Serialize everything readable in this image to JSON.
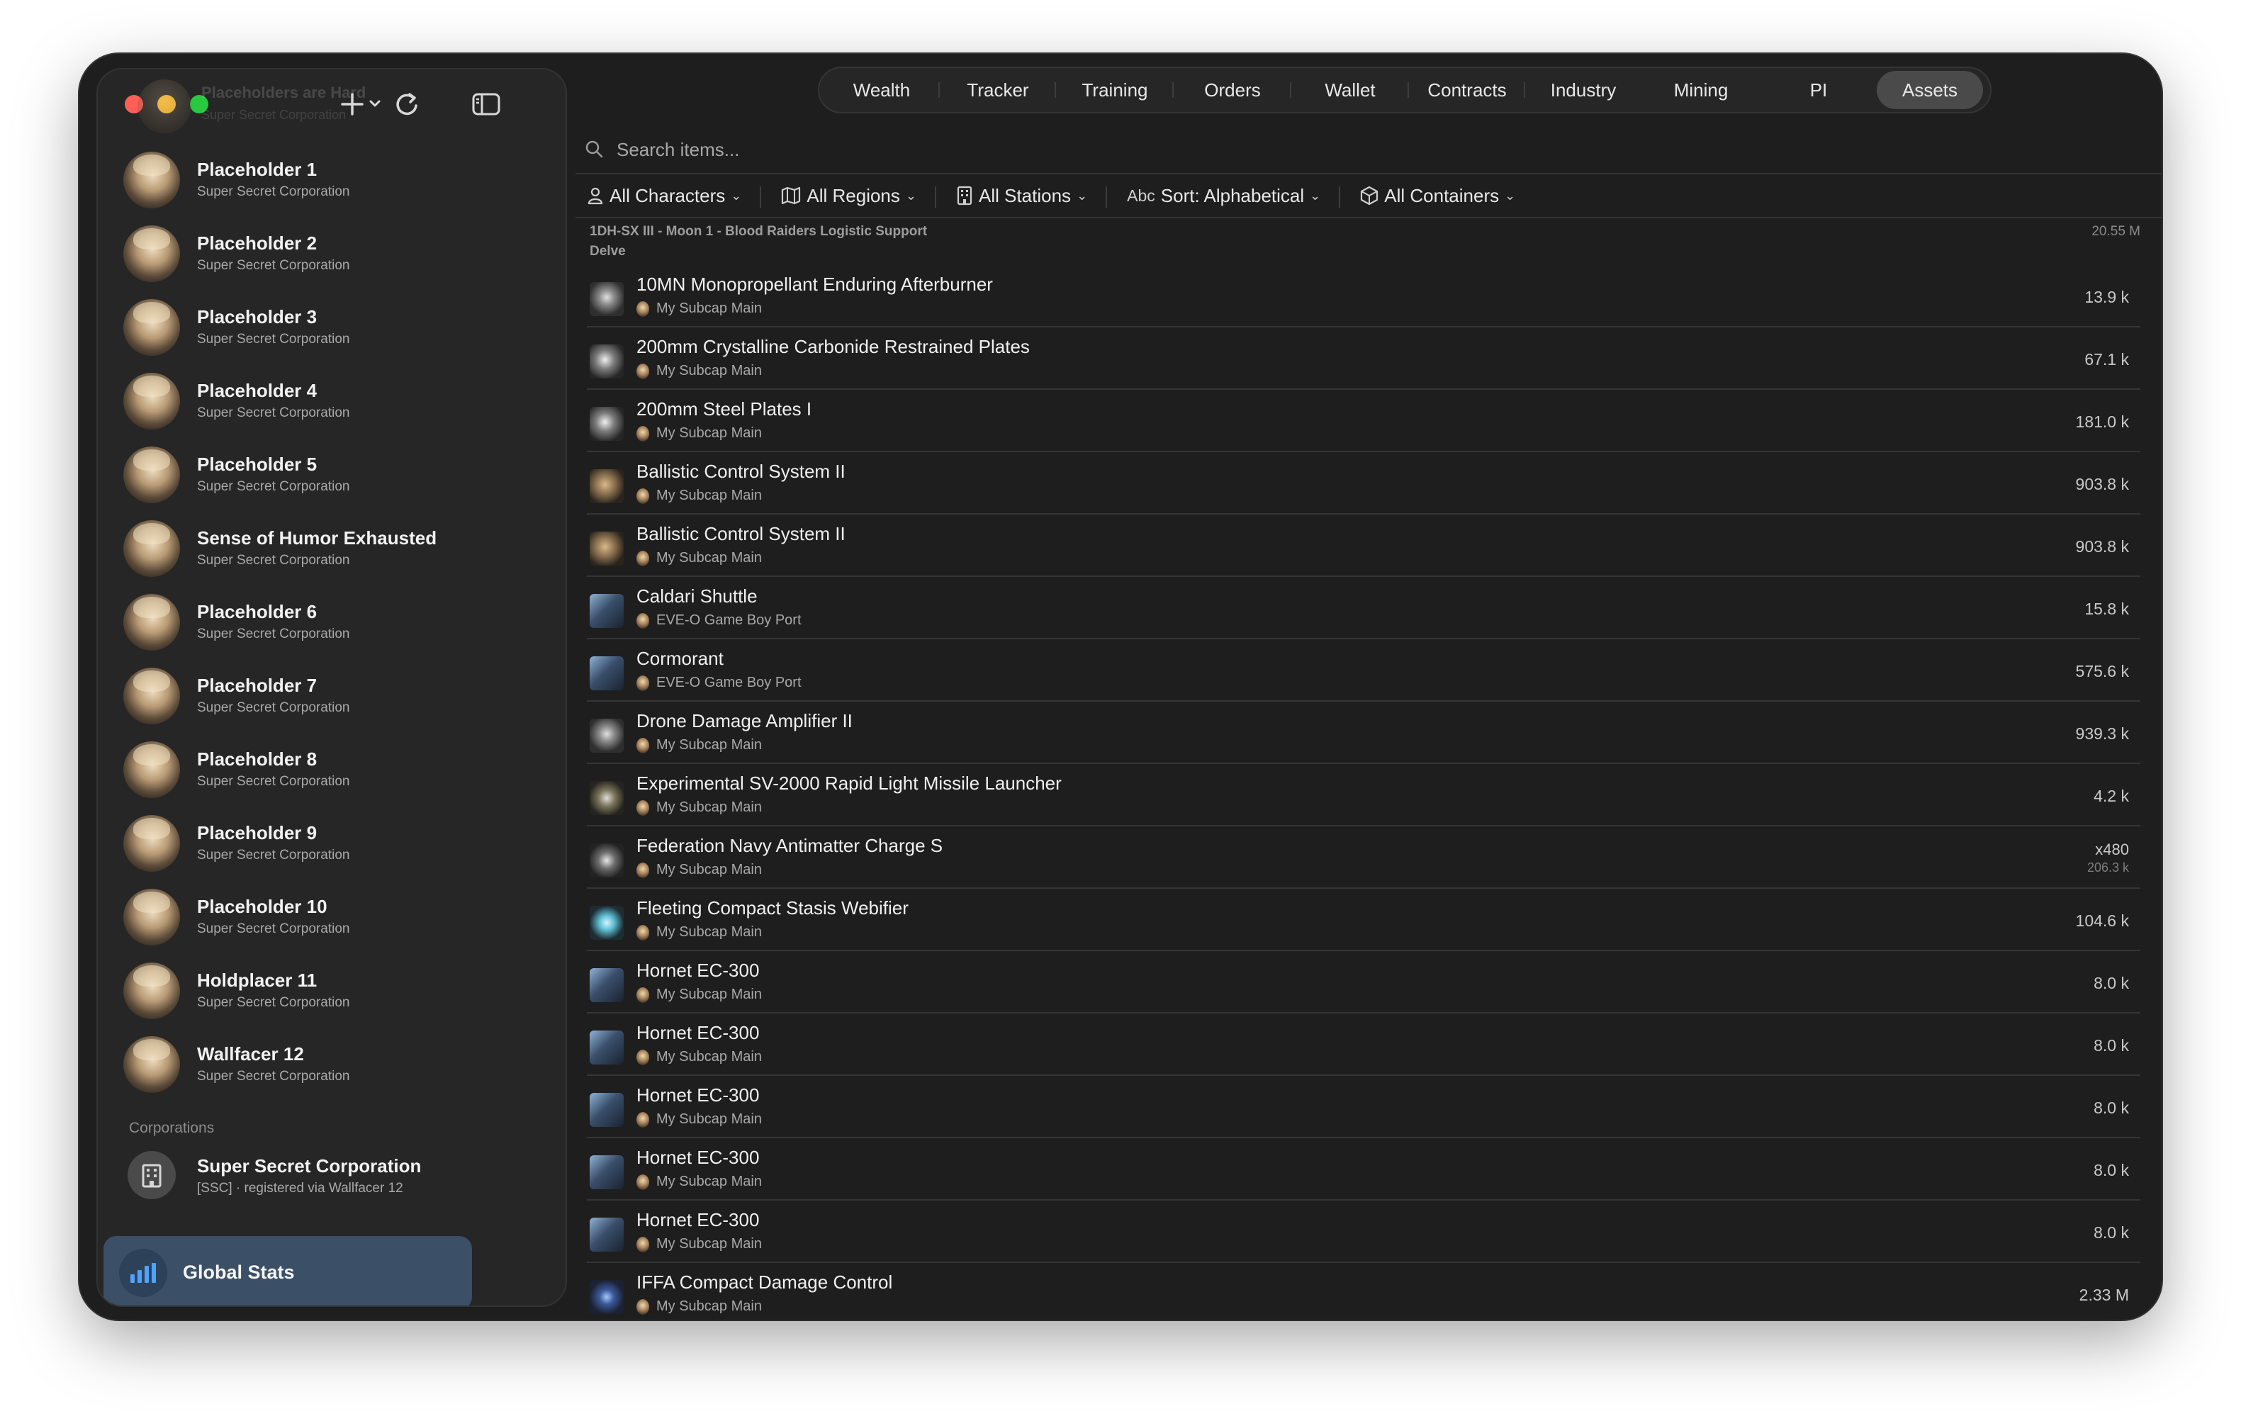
{
  "sidebar": {
    "ghost_title": "Placeholders are Hard",
    "ghost_sub": "Super Secret Corporation",
    "characters": [
      {
        "name": "Placeholder 1",
        "corp": "Super Secret Corporation"
      },
      {
        "name": "Placeholder 2",
        "corp": "Super Secret Corporation"
      },
      {
        "name": "Placeholder 3",
        "corp": "Super Secret Corporation"
      },
      {
        "name": "Placeholder 4",
        "corp": "Super Secret Corporation"
      },
      {
        "name": "Placeholder 5",
        "corp": "Super Secret Corporation"
      },
      {
        "name": "Sense of Humor Exhausted",
        "corp": "Super Secret Corporation"
      },
      {
        "name": "Placeholder 6",
        "corp": "Super Secret Corporation"
      },
      {
        "name": "Placeholder 7",
        "corp": "Super Secret Corporation"
      },
      {
        "name": "Placeholder 8",
        "corp": "Super Secret Corporation"
      },
      {
        "name": "Placeholder 9",
        "corp": "Super Secret Corporation"
      },
      {
        "name": "Placeholder 10",
        "corp": "Super Secret Corporation"
      },
      {
        "name": "Holdplacer 11",
        "corp": "Super Secret Corporation"
      },
      {
        "name": "Wallfacer 12",
        "corp": "Super Secret Corporation"
      }
    ],
    "corporations_label": "Corporations",
    "corporation": {
      "name": "Super Secret Corporation",
      "sub": "[SSC] · registered via Wallfacer 12"
    },
    "global_stats_label": "Global Stats",
    "icons": {
      "add": "plus-icon",
      "menu": "chevron-down-icon",
      "refresh": "refresh-icon",
      "toggle": "sidebar-toggle-icon"
    }
  },
  "tabs": [
    {
      "label": "Wealth",
      "active": false
    },
    {
      "label": "Tracker",
      "active": false
    },
    {
      "label": "Training",
      "active": false
    },
    {
      "label": "Orders",
      "active": false
    },
    {
      "label": "Wallet",
      "active": false
    },
    {
      "label": "Contracts",
      "active": false
    },
    {
      "label": "Industry",
      "active": false
    },
    {
      "label": "Mining",
      "active": false
    },
    {
      "label": "PI",
      "active": false
    },
    {
      "label": "Assets",
      "active": true
    }
  ],
  "search": {
    "placeholder": "Search items..."
  },
  "filters": [
    {
      "label": "All Characters",
      "icon": "person-icon"
    },
    {
      "label": "All Regions",
      "icon": "map-icon"
    },
    {
      "label": "All Stations",
      "icon": "building-icon"
    },
    {
      "label": "Sort: Alphabetical",
      "icon": "abc-icon",
      "prefix": "Abc"
    },
    {
      "label": "All Containers",
      "icon": "box-icon"
    }
  ],
  "location": {
    "name": "1DH-SX III - Moon 1 - Blood Raiders Logistic Support",
    "region": "Delve",
    "value": "20.55 M"
  },
  "assets": [
    {
      "name": "10MN Monopropellant Enduring Afterburner",
      "owner": "My Subcap Main",
      "value": "13.9 k",
      "kind": "module"
    },
    {
      "name": "200mm Crystalline Carbonide Restrained Plates",
      "owner": "My Subcap Main",
      "value": "67.1 k",
      "kind": "plate"
    },
    {
      "name": "200mm Steel Plates I",
      "owner": "My Subcap Main",
      "value": "181.0 k",
      "kind": "plate"
    },
    {
      "name": "Ballistic Control System II",
      "owner": "My Subcap Main",
      "value": "903.8 k",
      "kind": "ballistic"
    },
    {
      "name": "Ballistic Control System II",
      "owner": "My Subcap Main",
      "value": "903.8 k",
      "kind": "ballistic"
    },
    {
      "name": "Caldari Shuttle",
      "owner": "EVE-O Game Boy Port",
      "value": "15.8 k",
      "kind": "ship"
    },
    {
      "name": "Cormorant",
      "owner": "EVE-O Game Boy Port",
      "value": "575.6 k",
      "kind": "ship"
    },
    {
      "name": "Drone Damage Amplifier II",
      "owner": "My Subcap Main",
      "value": "939.3 k",
      "kind": "module"
    },
    {
      "name": "Experimental SV-2000 Rapid Light Missile Launcher",
      "owner": "My Subcap Main",
      "value": "4.2 k",
      "kind": "missile"
    },
    {
      "name": "Federation Navy Antimatter Charge S",
      "owner": "My Subcap Main",
      "qty": "x480",
      "value": "206.3 k",
      "kind": "charge"
    },
    {
      "name": "Fleeting Compact Stasis Webifier",
      "owner": "My Subcap Main",
      "value": "104.6 k",
      "kind": "web"
    },
    {
      "name": "Hornet EC-300",
      "owner": "My Subcap Main",
      "value": "8.0 k",
      "kind": "ship"
    },
    {
      "name": "Hornet EC-300",
      "owner": "My Subcap Main",
      "value": "8.0 k",
      "kind": "ship"
    },
    {
      "name": "Hornet EC-300",
      "owner": "My Subcap Main",
      "value": "8.0 k",
      "kind": "ship"
    },
    {
      "name": "Hornet EC-300",
      "owner": "My Subcap Main",
      "value": "8.0 k",
      "kind": "ship"
    },
    {
      "name": "Hornet EC-300",
      "owner": "My Subcap Main",
      "value": "8.0 k",
      "kind": "ship"
    },
    {
      "name": "IFFA Compact Damage Control",
      "owner": "My Subcap Main",
      "value": "2.33 M",
      "kind": "dc"
    }
  ],
  "colors": {
    "accent": "#4fa3ff",
    "selected": "#3b4f66",
    "background": "#1e1e1e"
  }
}
